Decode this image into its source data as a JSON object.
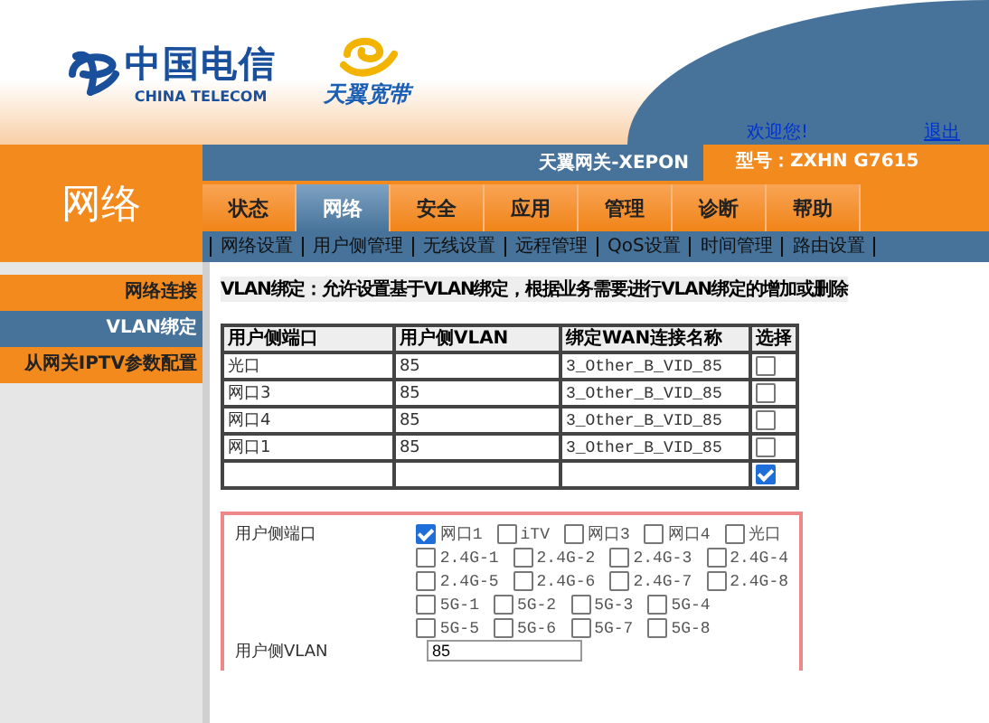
{
  "header": {
    "logo_text": "中国电信",
    "logo_subtext": "CHINA TELECOM",
    "brand": "天翼宽带",
    "welcome": "欢迎您!",
    "logout": "退出"
  },
  "section_title": "网络",
  "gateway_name": "天翼网关-XEPON",
  "model": "型号：ZXHN G7615",
  "tabs": [
    {
      "label": "状态",
      "selected": false
    },
    {
      "label": "网络",
      "selected": true
    },
    {
      "label": "安全",
      "selected": false
    },
    {
      "label": "应用",
      "selected": false
    },
    {
      "label": "管理",
      "selected": false
    },
    {
      "label": "诊断",
      "selected": false
    },
    {
      "label": "帮助",
      "selected": false
    }
  ],
  "subtabs": [
    "网络设置",
    "用户侧管理",
    "无线设置",
    "远程管理",
    "QoS设置",
    "时间管理",
    "路由设置"
  ],
  "sidebar": [
    {
      "label": "网络连接",
      "selected": false
    },
    {
      "label": "VLAN绑定",
      "selected": true
    },
    {
      "label": "从网关IPTV参数配置",
      "selected": false
    }
  ],
  "description": "VLAN绑定：允许设置基于VLAN绑定，根据业务需要进行VLAN绑定的增加或删除",
  "table": {
    "columns": [
      "用户侧端口",
      "用户侧VLAN",
      "绑定WAN连接名称",
      "选择"
    ],
    "rows": [
      {
        "port": "光口",
        "vlan": "85",
        "wan": "3_Other_B_VID_85",
        "checked": false
      },
      {
        "port": "网口3",
        "vlan": "85",
        "wan": "3_Other_B_VID_85",
        "checked": false
      },
      {
        "port": "网口4",
        "vlan": "85",
        "wan": "3_Other_B_VID_85",
        "checked": false
      },
      {
        "port": "网口1",
        "vlan": "85",
        "wan": "3_Other_B_VID_85",
        "checked": false
      },
      {
        "port": "",
        "vlan": "",
        "wan": "",
        "checked": true
      }
    ]
  },
  "form": {
    "port_label": "用户侧端口",
    "port_groups": [
      [
        {
          "label": "网口1",
          "checked": true
        },
        {
          "label": "iTV",
          "checked": false
        },
        {
          "label": "网口3",
          "checked": false
        },
        {
          "label": "网口4",
          "checked": false
        },
        {
          "label": "光口",
          "checked": false
        }
      ],
      [
        {
          "label": "2.4G-1",
          "checked": false
        },
        {
          "label": "2.4G-2",
          "checked": false
        },
        {
          "label": "2.4G-3",
          "checked": false
        },
        {
          "label": "2.4G-4",
          "checked": false
        }
      ],
      [
        {
          "label": "2.4G-5",
          "checked": false
        },
        {
          "label": "2.4G-6",
          "checked": false
        },
        {
          "label": "2.4G-7",
          "checked": false
        },
        {
          "label": "2.4G-8",
          "checked": false
        }
      ],
      [
        {
          "label": "5G-1",
          "checked": false
        },
        {
          "label": "5G-2",
          "checked": false
        },
        {
          "label": "5G-3",
          "checked": false
        },
        {
          "label": "5G-4",
          "checked": false
        }
      ],
      [
        {
          "label": "5G-5",
          "checked": false
        },
        {
          "label": "5G-6",
          "checked": false
        },
        {
          "label": "5G-7",
          "checked": false
        },
        {
          "label": "5G-8",
          "checked": false
        }
      ]
    ],
    "vlan_label": "用户侧VLAN",
    "vlan_value": "85"
  }
}
